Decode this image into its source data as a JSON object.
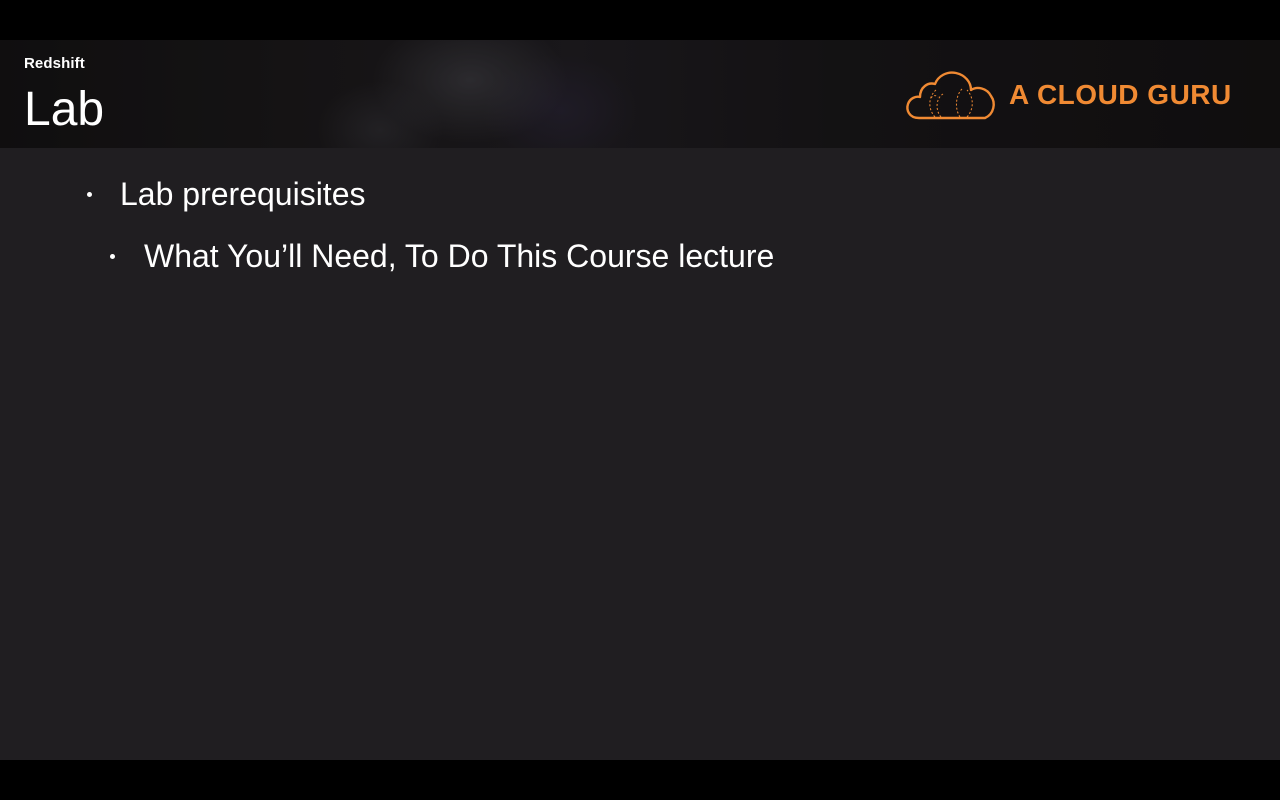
{
  "header": {
    "section": "Redshift",
    "title": "Lab"
  },
  "logo": {
    "text": "A CLOUD GURU",
    "icon": "cloud-icon",
    "color": "#f08a33"
  },
  "bullets": [
    {
      "text": "Lab prerequisites",
      "level": 1
    },
    {
      "text": "What You’ll Need, To Do This Course lecture",
      "level": 2
    }
  ],
  "colors": {
    "slide_background": "#201e21",
    "text": "#ffffff",
    "letterbox": "#000000"
  }
}
